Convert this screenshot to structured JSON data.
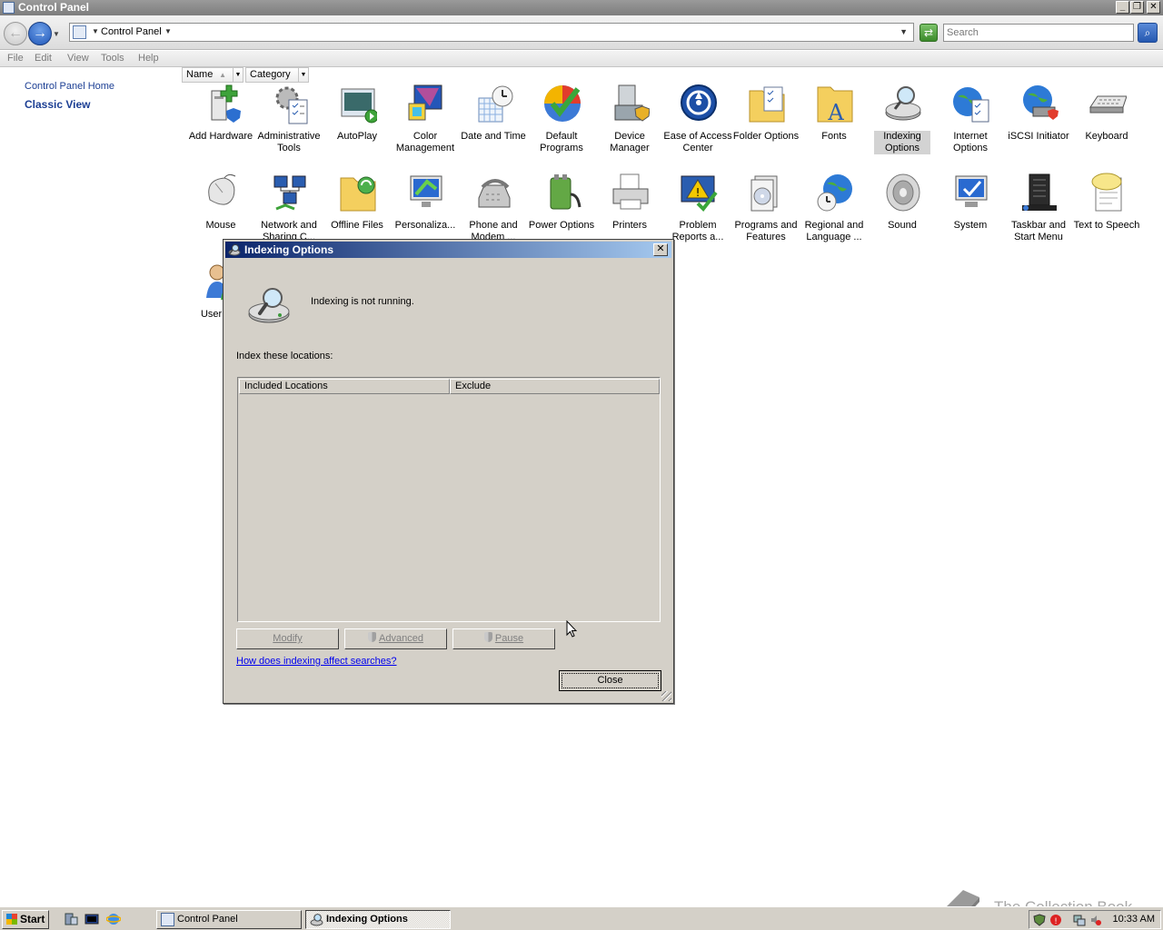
{
  "window": {
    "title": "Control Panel"
  },
  "address": {
    "path": "Control Panel",
    "search_placeholder": "Search"
  },
  "menu": [
    "File",
    "Edit",
    "View",
    "Tools",
    "Help"
  ],
  "leftnav": {
    "home": "Control Panel Home",
    "classic": "Classic View"
  },
  "columns": {
    "name": "Name",
    "category": "Category"
  },
  "items": [
    {
      "label": "Add Hardware",
      "icon": "add-hardware-icon"
    },
    {
      "label": "Administrative Tools",
      "icon": "administrative-tools-icon"
    },
    {
      "label": "AutoPlay",
      "icon": "autoplay-icon"
    },
    {
      "label": "Color Management",
      "icon": "color-management-icon"
    },
    {
      "label": "Date and Time",
      "icon": "date-time-icon"
    },
    {
      "label": "Default Programs",
      "icon": "default-programs-icon"
    },
    {
      "label": "Device Manager",
      "icon": "device-manager-icon"
    },
    {
      "label": "Ease of Access Center",
      "icon": "ease-of-access-icon"
    },
    {
      "label": "Folder Options",
      "icon": "folder-options-icon"
    },
    {
      "label": "Fonts",
      "icon": "fonts-icon"
    },
    {
      "label": "Indexing Options",
      "icon": "indexing-options-icon"
    },
    {
      "label": "Internet Options",
      "icon": "internet-options-icon"
    },
    {
      "label": "iSCSI Initiator",
      "icon": "iscsi-initiator-icon"
    },
    {
      "label": "Keyboard",
      "icon": "keyboard-icon"
    },
    {
      "label": "Mouse",
      "icon": "mouse-icon"
    },
    {
      "label": "Network and Sharing C...",
      "icon": "network-sharing-icon"
    },
    {
      "label": "Offline Files",
      "icon": "offline-files-icon"
    },
    {
      "label": "Personaliza...",
      "icon": "personalization-icon"
    },
    {
      "label": "Phone and Modem ...",
      "icon": "phone-modem-icon"
    },
    {
      "label": "Power Options",
      "icon": "power-options-icon"
    },
    {
      "label": "Printers",
      "icon": "printers-icon"
    },
    {
      "label": "Problem Reports a...",
      "icon": "problem-reports-icon"
    },
    {
      "label": "Programs and Features",
      "icon": "programs-features-icon"
    },
    {
      "label": "Regional and Language ...",
      "icon": "regional-language-icon"
    },
    {
      "label": "Sound",
      "icon": "sound-icon"
    },
    {
      "label": "System",
      "icon": "system-icon"
    },
    {
      "label": "Taskbar and Start Menu",
      "icon": "taskbar-start-menu-icon"
    },
    {
      "label": "Text to Speech",
      "icon": "text-to-speech-icon"
    },
    {
      "label": "User Acc",
      "icon": "user-accounts-icon"
    }
  ],
  "selected_item": "Indexing Options",
  "dialog": {
    "title": "Indexing Options",
    "status": "Indexing is not running.",
    "locations_label": "Index these locations:",
    "col_included": "Included Locations",
    "col_exclude": "Exclude",
    "modify": "Modify",
    "advanced": "Advanced",
    "pause": "Pause",
    "help_link": "How does indexing affect searches?",
    "close": "Close"
  },
  "taskbar": {
    "start": "Start",
    "tasks": [
      "Control Panel",
      "Indexing Options"
    ],
    "active_task": "Indexing Options",
    "clock": "10:33 AM"
  },
  "watermark": "The Collection Book",
  "colors": {
    "dialog_title_start": "#0a246a",
    "dialog_title_end": "#a6caf0",
    "link": "#1c3f94"
  }
}
